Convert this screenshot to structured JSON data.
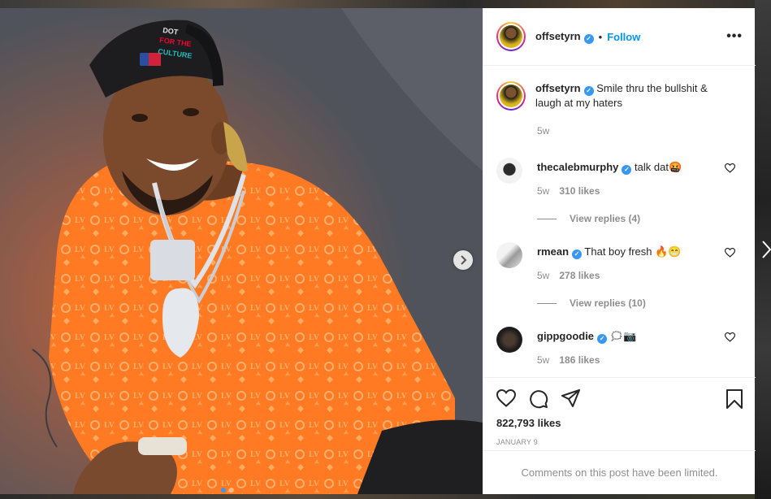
{
  "post": {
    "username": "offsetyrn",
    "follow_label": "Follow",
    "more_label": "•••",
    "caption": "Smile thru the bullshit & laugh at my haters",
    "caption_time": "5w",
    "likes": "822,793 likes",
    "date": "JANUARY 9",
    "comments_limited": "Comments on this post have been limited."
  },
  "comments": [
    {
      "username": "thecalebmurphy",
      "text": "talk dat🤬",
      "time": "5w",
      "likes": "310 likes",
      "replies": "View replies (4)"
    },
    {
      "username": "rmean",
      "text": "That boy fresh 🔥😁",
      "time": "5w",
      "likes": "278 likes",
      "replies": "View replies (10)"
    },
    {
      "username": "gippgoodie",
      "text": "🗯📷",
      "time": "5w",
      "likes": "186 likes",
      "replies": ""
    }
  ],
  "icons": {
    "verified": "verified-badge-icon",
    "more": "more-options-icon",
    "like": "heart-icon",
    "comment": "comment-icon",
    "share": "share-icon",
    "save": "bookmark-icon",
    "next": "chevron-right-icon"
  },
  "colors": {
    "accent": "#0095f6",
    "verified": "#3897f0",
    "muted": "#8e8e8e"
  }
}
